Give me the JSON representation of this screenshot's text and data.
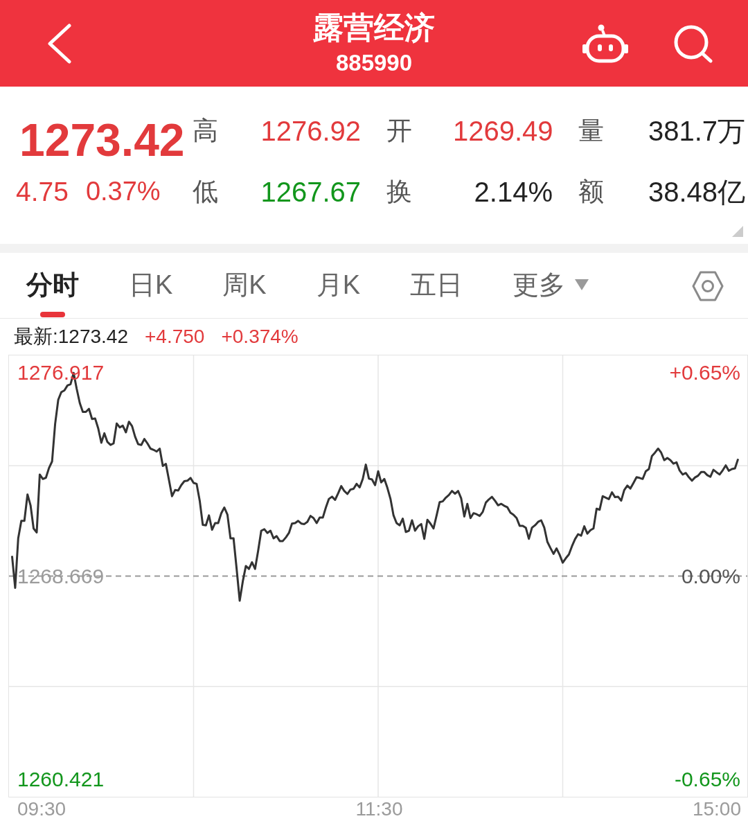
{
  "header": {
    "title": "露营经济",
    "code": "885990"
  },
  "quote": {
    "price": {
      "text": "1273.42",
      "color": "#e23a3c"
    },
    "change": {
      "text": "4.75",
      "color": "#e23a3c"
    },
    "change_percent": {
      "text": "0.37%",
      "color": "#e23a3c"
    },
    "stat_rows": [
      [
        {
          "label": "高",
          "value": "1276.92",
          "color": "#e23a3c"
        },
        {
          "label": "开",
          "value": "1269.49",
          "color": "#e23a3c"
        },
        {
          "label": "量",
          "value": "381.7万",
          "color": "#222222"
        }
      ],
      [
        {
          "label": "低",
          "value": "1267.67",
          "color": "#12961c"
        },
        {
          "label": "换",
          "value": "2.14%",
          "color": "#222222"
        },
        {
          "label": "额",
          "value": "38.48亿",
          "color": "#222222"
        }
      ]
    ]
  },
  "tabs": [
    {
      "label": "分时",
      "selected": true,
      "dropdown": false
    },
    {
      "label": "日K",
      "selected": false,
      "dropdown": false
    },
    {
      "label": "周K",
      "selected": false,
      "dropdown": false
    },
    {
      "label": "月K",
      "selected": false,
      "dropdown": false
    },
    {
      "label": "五日",
      "selected": false,
      "dropdown": false
    },
    {
      "label": "更多",
      "selected": false,
      "dropdown": true
    }
  ],
  "latest": {
    "text": "最新:1273.42",
    "change": {
      "text": "+4.750",
      "color": "#e23a3c"
    },
    "change_percent": {
      "text": "+0.374%",
      "color": "#e23a3c"
    }
  },
  "chart": {
    "right_axis_labels": [
      "+0.65%",
      "0.00%",
      "-0.65%"
    ],
    "chart_data": {
      "type": "line",
      "ylim": [
        1259.718,
        1277.62
      ],
      "yticks": [
        {
          "value": 1276.917,
          "label": "1276.917"
        },
        {
          "value": 1268.669,
          "label": "1268.669"
        },
        {
          "value": 1260.421,
          "label": "1260.421"
        }
      ],
      "ref_lines": [
        {
          "axis": "y",
          "value": 1268.669
        }
      ],
      "categories": [
        null,
        null,
        null,
        null,
        null,
        null,
        null,
        null,
        null,
        null,
        null,
        null,
        null,
        null,
        null,
        null,
        null,
        null,
        null,
        null,
        null,
        null,
        null,
        null,
        null,
        null,
        null,
        null,
        null,
        null,
        null,
        null,
        null,
        null,
        null,
        null,
        null,
        null,
        null,
        null,
        null,
        null,
        null,
        null,
        null,
        null,
        null,
        null,
        null,
        null,
        null,
        null,
        null,
        null,
        null,
        null,
        null,
        null,
        null,
        null,
        null,
        null,
        null,
        null,
        null,
        null,
        null,
        null,
        null,
        null,
        null,
        null,
        null,
        null,
        null,
        null,
        null,
        null,
        null,
        null,
        null,
        null,
        null,
        null,
        null,
        null,
        null,
        null,
        null,
        null,
        null,
        null,
        null,
        null,
        null,
        null,
        null,
        null,
        null,
        null,
        null,
        null,
        null,
        null,
        null,
        null,
        null,
        null,
        null,
        null,
        null,
        null,
        null,
        null,
        null,
        null,
        null,
        null,
        null,
        null,
        null,
        null,
        null,
        null,
        null,
        null,
        null,
        null,
        null,
        null,
        null,
        null,
        null,
        null,
        null,
        null,
        null,
        null,
        null,
        null,
        null,
        null,
        null,
        null,
        null,
        null,
        null,
        null,
        null,
        null,
        null,
        null,
        null,
        null,
        null,
        null,
        null,
        null,
        null,
        null,
        null,
        null,
        null,
        null,
        null,
        null,
        null,
        null,
        null,
        null,
        null,
        null,
        null,
        null,
        null,
        null,
        null,
        null,
        null,
        null,
        null,
        null,
        null,
        null,
        null,
        null,
        null,
        null,
        null,
        null,
        null,
        null,
        null,
        null,
        null,
        null,
        null,
        null,
        null,
        null,
        null,
        null,
        null,
        null,
        null,
        null,
        null,
        null,
        null,
        null,
        null,
        null,
        null,
        null,
        null,
        null,
        null,
        null,
        null,
        null,
        null,
        null,
        null,
        null,
        null,
        null,
        null,
        null,
        null,
        null,
        null,
        null,
        null,
        null,
        null,
        null,
        null,
        null,
        null,
        null,
        null
      ],
      "series": [
        {
          "color": "#333333",
          "values": [
            null,
            1269.49,
            1268.19,
            1270.2,
            1270.91,
            1270.91,
            1271.98,
            1271.54,
            1270.6,
            1270.44,
            1272.79,
            1272.61,
            1272.66,
            1273.05,
            1273.32,
            1274.84,
            1275.82,
            1276.13,
            1276.2,
            1276.4,
            1276.45,
            1276.91,
            1276.27,
            1275.69,
            1275.33,
            1275.33,
            1275.45,
            1275.04,
            1275.06,
            1274.66,
            1274.08,
            1274.46,
            1274.11,
            1273.99,
            1274.05,
            1274.86,
            1274.7,
            1274.77,
            1274.5,
            1274.93,
            1274.75,
            1274.32,
            1274.02,
            1273.99,
            1274.23,
            1274.05,
            1273.84,
            1273.79,
            1273.72,
            1273.84,
            1273.14,
            1273.22,
            1272.56,
            1271.91,
            1272.16,
            1272.14,
            1272.36,
            1272.52,
            1272.54,
            1272.65,
            1272.45,
            1272.41,
            1271.72,
            1270.75,
            1270.73,
            1271.13,
            1270.55,
            1270.82,
            1270.82,
            1271.22,
            1271.45,
            1271.16,
            1270.2,
            1270.2,
            1268.95,
            1267.67,
            1268.46,
            1269.08,
            1268.96,
            1269.23,
            1268.96,
            1269.71,
            1270.51,
            1270.57,
            1270.42,
            1270.51,
            1270.2,
            1270.29,
            1270.09,
            1270.09,
            1270.24,
            1270.42,
            1270.8,
            1270.82,
            1270.91,
            1270.8,
            1270.78,
            1270.87,
            1271.11,
            1271.02,
            1270.82,
            1271.04,
            1271.04,
            1271.45,
            1271.8,
            1271.89,
            1271.76,
            1272.03,
            1272.32,
            1272.12,
            1272.0,
            1272.18,
            1272.21,
            1272.41,
            1272.27,
            1272.61,
            1273.19,
            1272.62,
            1272.59,
            1272.36,
            1272.92,
            1272.47,
            1272.61,
            1272.25,
            1271.8,
            1271.13,
            1270.82,
            1270.73,
            1271.0,
            1270.46,
            1270.51,
            1270.93,
            1270.51,
            1270.69,
            1270.78,
            1270.18,
            1270.95,
            1270.8,
            1270.6,
            1271.13,
            1271.67,
            1271.7,
            1271.85,
            1271.96,
            1272.12,
            1272.01,
            1272.12,
            1271.82,
            1271.09,
            1271.6,
            1271.02,
            1271.22,
            1271.18,
            1271.11,
            1271.27,
            1271.65,
            1271.78,
            1271.88,
            1271.72,
            1271.54,
            1271.6,
            1271.52,
            1271.46,
            1271.24,
            1271.16,
            1271.02,
            1270.71,
            1270.71,
            1270.63,
            1270.18,
            1270.63,
            1270.73,
            1270.87,
            1270.93,
            1270.63,
            1270.06,
            1269.81,
            1269.57,
            1269.79,
            1269.53,
            1269.21,
            1269.39,
            1269.55,
            1269.88,
            1270.17,
            1270.37,
            1270.31,
            1270.69,
            1270.39,
            1270.53,
            1270.6,
            1271.4,
            1271.36,
            1271.91,
            1271.85,
            1271.79,
            1272.07,
            1271.87,
            1271.89,
            1271.73,
            1272.16,
            1272.34,
            1272.22,
            1272.45,
            1272.68,
            1272.65,
            1272.61,
            1272.92,
            1273.01,
            1273.54,
            1273.68,
            1273.84,
            1273.68,
            1273.37,
            1273.46,
            1273.37,
            1273.23,
            1273.28,
            1272.95,
            1272.79,
            1272.85,
            1272.68,
            1272.54,
            1272.67,
            1272.74,
            1272.89,
            1272.89,
            1272.76,
            1272.7,
            1272.98,
            1272.88,
            1272.79,
            1272.96,
            1273.16,
            1272.94,
            1273.01,
            1273.04,
            1273.42,
            null,
            null,
            null
          ]
        }
      ]
    }
  },
  "time_axis_labels": [
    "09:30",
    "11:30",
    "15:00"
  ]
}
